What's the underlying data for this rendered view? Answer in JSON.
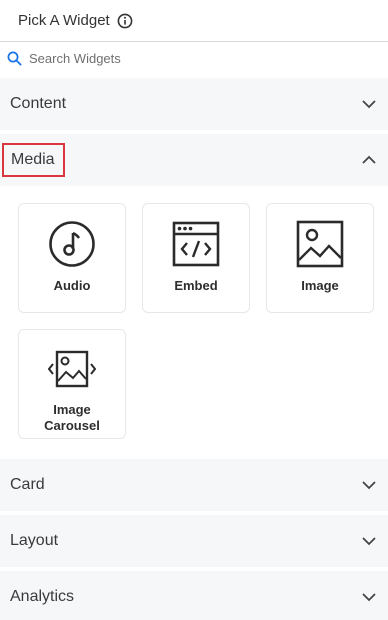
{
  "header": {
    "title": "Pick A Widget",
    "info_icon": "info-icon"
  },
  "search": {
    "placeholder": "Search Widgets",
    "icon": "search-icon",
    "value": ""
  },
  "accent": "#1a73e8",
  "highlight_color": "#d9363e",
  "sections": {
    "content": {
      "label": "Content",
      "expanded": false
    },
    "media": {
      "label": "Media",
      "expanded": true,
      "widgets": [
        {
          "label": "Audio",
          "icon": "audio-icon"
        },
        {
          "label": "Embed",
          "icon": "embed-icon"
        },
        {
          "label": "Image",
          "icon": "image-icon"
        },
        {
          "label": "Image Carousel",
          "icon": "image-carousel-icon"
        }
      ]
    },
    "card": {
      "label": "Card",
      "expanded": false
    },
    "layout": {
      "label": "Layout",
      "expanded": false
    },
    "analytics": {
      "label": "Analytics",
      "expanded": false
    }
  }
}
